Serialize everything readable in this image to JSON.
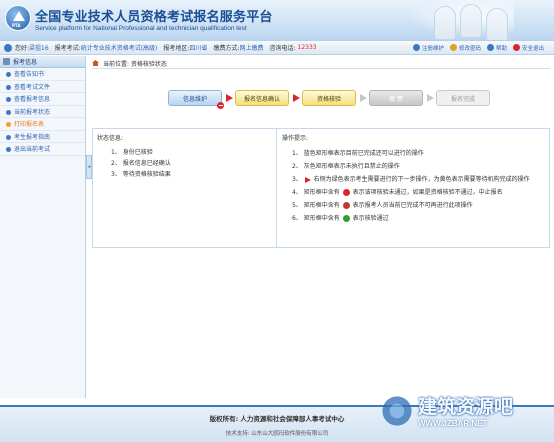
{
  "header": {
    "logo_text": "PTA",
    "title_cn": "全国专业技术人员资格考试报名服务平台",
    "title_en": "Service platform for National Professional and technician qualification test"
  },
  "infobar": {
    "welcome_label": "您好:",
    "user_name": "梁祖16",
    "exam_name_label": "报考考试:",
    "exam_name": "统计专业技术资格考试(高级)",
    "region_label": "报考地区:",
    "region": "四川省",
    "payment_label": "缴费方式:",
    "payment": "网上缴费",
    "phone_label": "咨询电话:",
    "phone": "12333"
  },
  "toplinks": {
    "register_info": "注册维护",
    "change_password": "修改密码",
    "help": "帮助",
    "logout": "安全退出"
  },
  "sidebar": {
    "header": "报考信息",
    "items": [
      {
        "label": "查看告知书"
      },
      {
        "label": "查看考试文件"
      },
      {
        "label": "查看报考信息"
      },
      {
        "label": "当前报考状态"
      },
      {
        "label": "打印报名表"
      },
      {
        "label": "考生报考指南"
      },
      {
        "label": "退出当前考试"
      }
    ],
    "collapse_glyph": "◂"
  },
  "breadcrumb": {
    "text": "当前位置: 资格核验状态"
  },
  "steps": [
    {
      "label": "信息维护",
      "state": "blue"
    },
    {
      "label": "报名信息确认",
      "state": "yellow"
    },
    {
      "label": "资格核验",
      "state": "yellow"
    },
    {
      "label": "缴 费",
      "state": "gray"
    },
    {
      "label": "报名完成",
      "state": "gray2"
    }
  ],
  "status_panel": {
    "title": "状态信息:",
    "lines": [
      "1、 身份已核验",
      "2、 报名信息已经确认",
      "3、 等待资格核验结果"
    ]
  },
  "tips_panel": {
    "title": "操作提示:",
    "lines": {
      "l1": "1、 蓝色矩形框表示目前已完成还可以进行的操作",
      "l2": "2、 灰色矩形框表示未执行且禁止的操作",
      "l3a": "3、",
      "l3b": "右侧为绿色表示考生需要进行的下一步操作，为黄色表示需要等待机构完成的操作",
      "l4a": "4、 矩形框中含有",
      "l4b": "表示该项核验未通过，如果是资格核验不通过，中止报名",
      "l5a": "5、 矩形框中含有",
      "l5b": "表示报考人员当前已完成不可再进行此项操作",
      "l6a": "6、 矩形框中含有",
      "l6b": "表示核验通过"
    }
  },
  "footer": {
    "copyright": "版权所有: 人力资源和社会保障部人事考试中心",
    "support": "技术支持: 山东山大鸥玛软件股份有限公司"
  },
  "watermark": {
    "cn": "建筑资源吧",
    "en": "WWW.JZBAR.NET"
  },
  "colors": {
    "brand": "#1a4f96",
    "accent_red": "#d9262c",
    "link": "#2f66b3",
    "active": "#f07a20"
  }
}
